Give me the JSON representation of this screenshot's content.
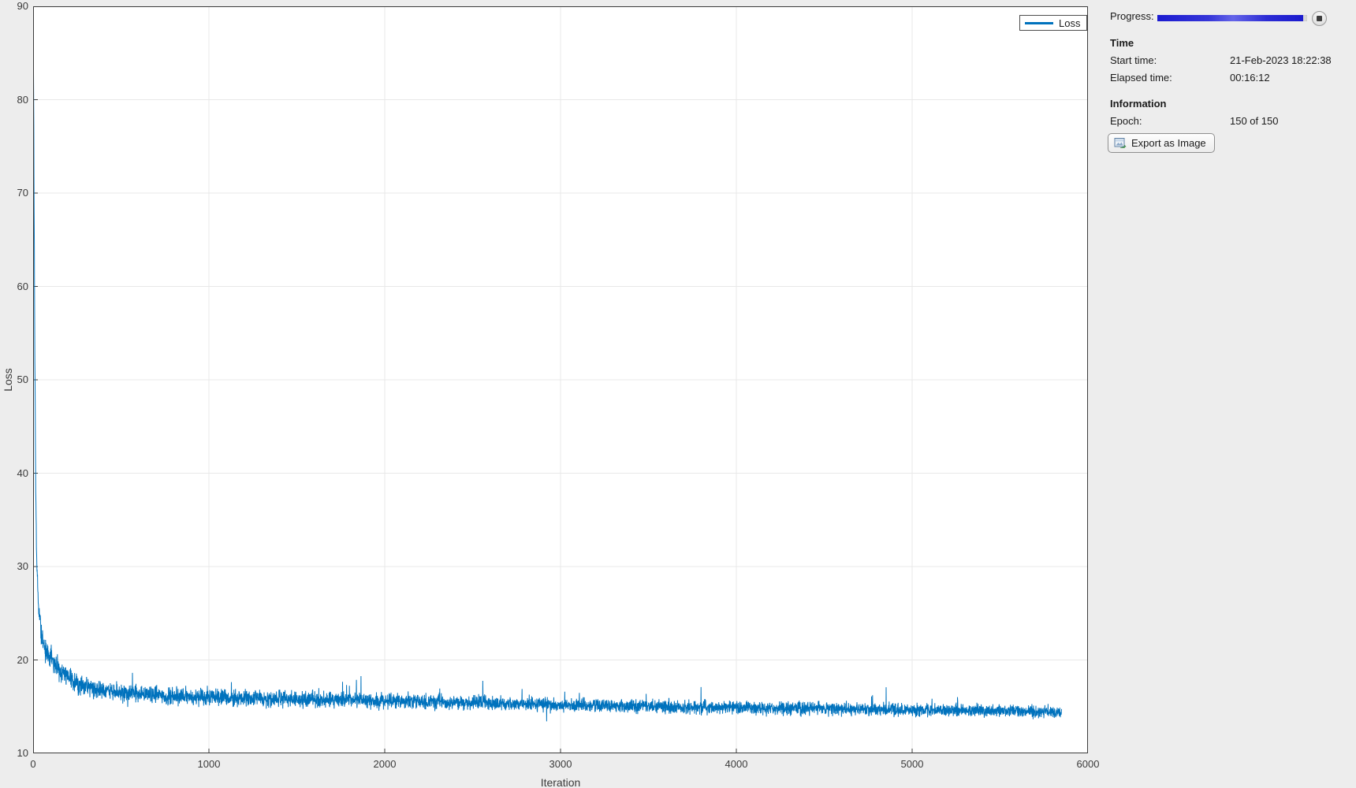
{
  "window": {
    "background": "#ededed",
    "plot_background": "#ffffff",
    "grid_color": "#e8e8e8",
    "axis_color": "#3c3c3c"
  },
  "chart_data": {
    "type": "line",
    "title": "",
    "xlabel": "Iteration",
    "ylabel": "Loss",
    "xlim": [
      0,
      6000
    ],
    "ylim": [
      10,
      90
    ],
    "x_ticks": [
      0,
      1000,
      2000,
      3000,
      4000,
      5000,
      6000
    ],
    "y_ticks": [
      10,
      20,
      30,
      40,
      50,
      60,
      70,
      80,
      90
    ],
    "grid": true,
    "legend": {
      "position": "top-right",
      "entries": [
        {
          "label": "Loss",
          "color": "#0072BD"
        }
      ]
    },
    "series": [
      {
        "name": "Loss",
        "color": "#0072BD",
        "total_iterations": 5850,
        "trend_points": [
          [
            1,
            88.8
          ],
          [
            3,
            80
          ],
          [
            6,
            68
          ],
          [
            10,
            52
          ],
          [
            15,
            38
          ],
          [
            20,
            31
          ],
          [
            30,
            26
          ],
          [
            45,
            23
          ],
          [
            60,
            21.5
          ],
          [
            90,
            20.4
          ],
          [
            130,
            19.4
          ],
          [
            180,
            18.4
          ],
          [
            250,
            17.5
          ],
          [
            350,
            16.9
          ],
          [
            500,
            16.5
          ],
          [
            800,
            16.1
          ],
          [
            1200,
            15.9
          ],
          [
            1800,
            15.7
          ],
          [
            2400,
            15.45
          ],
          [
            3000,
            15.2
          ],
          [
            3600,
            15.0
          ],
          [
            4200,
            14.85
          ],
          [
            4800,
            14.7
          ],
          [
            5400,
            14.55
          ],
          [
            5850,
            14.45
          ]
        ],
        "noise_amplitude": [
          [
            1,
            0.4
          ],
          [
            40,
            1.8
          ],
          [
            90,
            1.9
          ],
          [
            200,
            1.5
          ],
          [
            600,
            1.35
          ],
          [
            1500,
            1.25
          ],
          [
            3000,
            1.05
          ],
          [
            5850,
            0.95
          ]
        ],
        "spikes": [
          [
            565,
            2.2
          ],
          [
            1865,
            2.6
          ]
        ]
      }
    ]
  },
  "panel": {
    "progress": {
      "label": "Progress:",
      "percent": 97.5
    },
    "stop_icon": "stop-icon",
    "time": {
      "heading": "Time",
      "rows": [
        {
          "label": "Start time:",
          "value": "21-Feb-2023 18:22:38"
        },
        {
          "label": "Elapsed time:",
          "value": "00:16:12"
        }
      ]
    },
    "information": {
      "heading": "Information",
      "rows": [
        {
          "label": "Epoch:",
          "value": "150 of 150"
        }
      ]
    },
    "export_button": {
      "label": "Export as Image",
      "icon": "export-image-icon"
    }
  }
}
